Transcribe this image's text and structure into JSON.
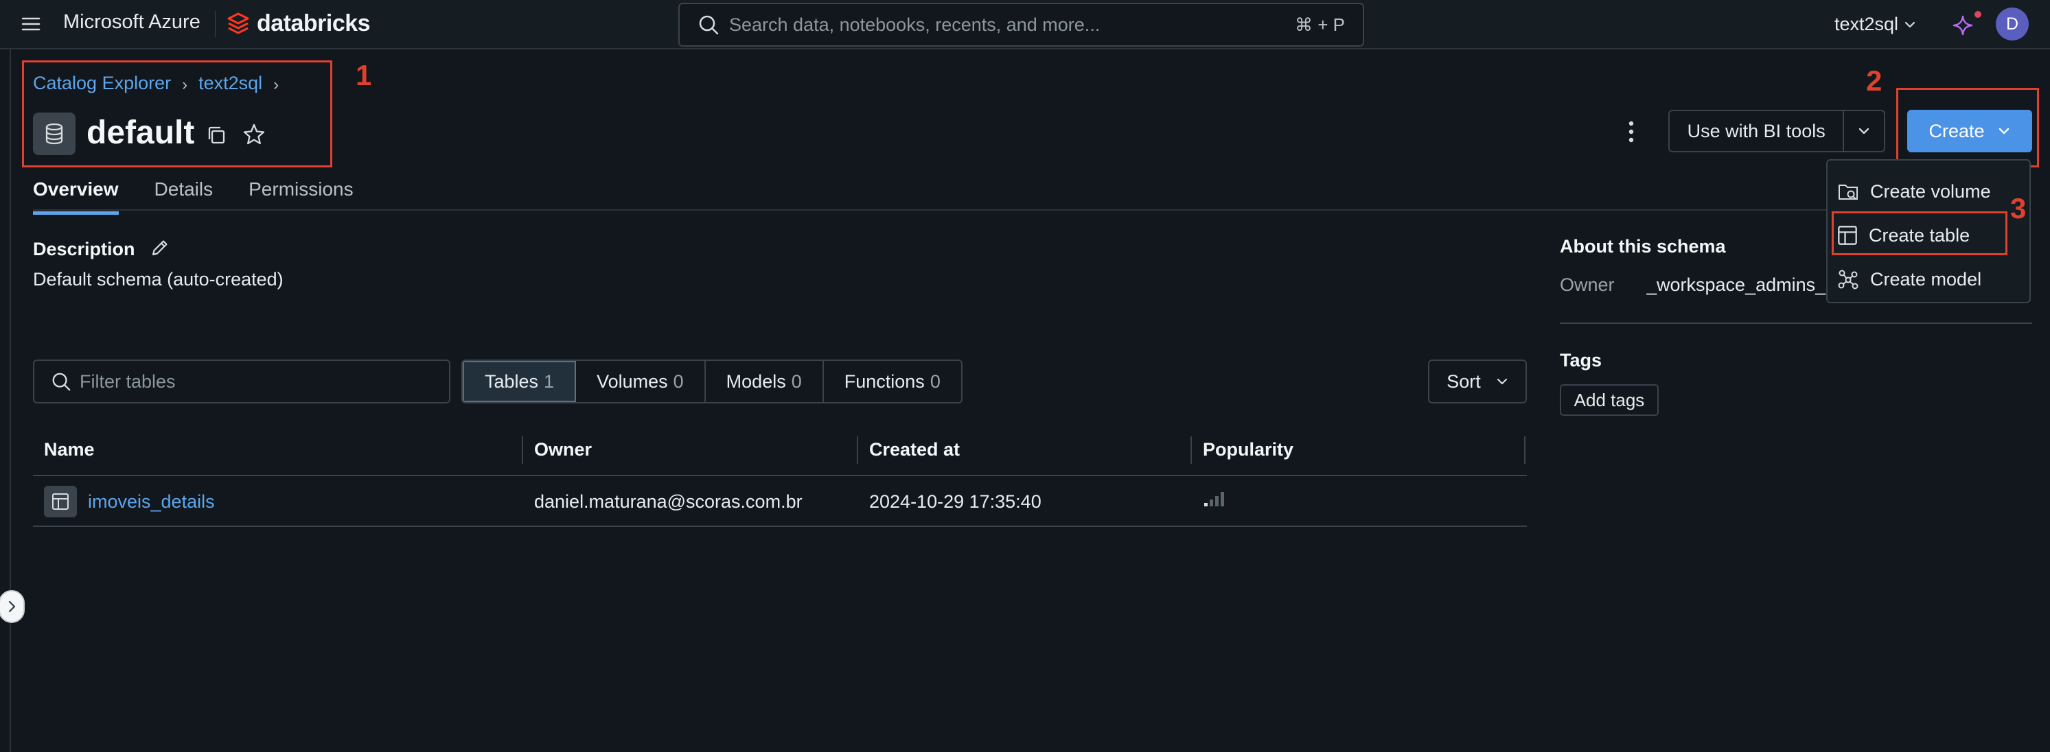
{
  "topbar": {
    "brand_microsoft": "Microsoft Azure",
    "brand_databricks": "databricks",
    "search_placeholder": "Search data, notebooks, recents, and more...",
    "search_shortcut": "⌘ + P",
    "workspace": "text2sql",
    "avatar_initial": "D"
  },
  "header": {
    "breadcrumb": [
      "Catalog Explorer",
      "text2sql"
    ],
    "title": "default",
    "bi_button": "Use with BI tools",
    "create_button": "Create"
  },
  "tabs": [
    "Overview",
    "Details",
    "Permissions"
  ],
  "description": {
    "label": "Description",
    "text": "Default schema (auto-created)"
  },
  "filter": {
    "placeholder": "Filter tables",
    "segments": [
      {
        "label": "Tables",
        "count": "1"
      },
      {
        "label": "Volumes",
        "count": "0"
      },
      {
        "label": "Models",
        "count": "0"
      },
      {
        "label": "Functions",
        "count": "0"
      }
    ],
    "active_segment": "Tables",
    "sort_label": "Sort"
  },
  "table": {
    "columns": [
      "Name",
      "Owner",
      "Created at",
      "Popularity"
    ],
    "rows": [
      {
        "name": "imoveis_details",
        "owner": "daniel.maturana@scoras.com.br",
        "created_at": "2024-10-29 17:35:40",
        "popularity_bars": 1
      }
    ]
  },
  "about": {
    "title": "About this schema",
    "owner_label": "Owner",
    "owner_value": "_workspace_admins_"
  },
  "tags": {
    "title": "Tags",
    "add_button": "Add tags"
  },
  "create_menu": {
    "items": [
      "Create volume",
      "Create table",
      "Create model"
    ]
  },
  "annotations": [
    "1",
    "2",
    "3"
  ],
  "colors": {
    "accent": "#4b93e6",
    "link": "#5ea5ec",
    "annotation": "#e0412f",
    "background": "#11171c"
  }
}
